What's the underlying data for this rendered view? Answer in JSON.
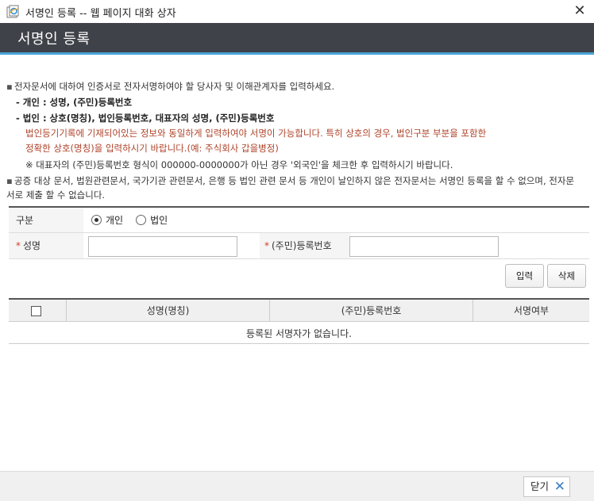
{
  "window": {
    "title": "서명인 등록 -- 웹 페이지 대화 상자",
    "close_glyph": "✕"
  },
  "header": {
    "title": "서명인 등록"
  },
  "notice": {
    "line1": "전자문서에 대하여 인증서로 전자서명하여야 할 당사자 및 이해관계자를 입력하세요.",
    "line2": "- 개인 : 성명, (주민)등록번호",
    "line3": "- 법인 : 상호(명칭), 법인등록번호, 대표자의 성명, (주민)등록번호",
    "line4": "법인등기기록에 기재되어있는 정보와 동일하게 입력하여야 서명이 가능합니다. 특히 상호의 경우, 법인구분 부분을 포함한",
    "line5": "정확한 상호(명칭)을 입력하시기 바랍니다.(예: 주식회사 갑을병정)",
    "line6": "※ 대표자의 (주민)등록번호 형식이 000000-0000000가 아닌 경우 '외국인'을 체크한 후 입력하시기 바랍니다.",
    "line7": "공증 대상 문서, 법원관련문서, 국가기관 관련문서, 은행 등 법인 관련 문서 등 개인이 날인하지 않은 전자문서는 서명인 등록을 할 수 없으며, 전자문",
    "line8": "서로 제출 할 수 없습니다.",
    "bullet": "▪"
  },
  "form": {
    "type_label": "구분",
    "radio_individual": "개인",
    "radio_corporation": "법인",
    "selected": "개인",
    "name_label": "성명",
    "reg_label": "(주민)등록번호",
    "required_mark": "*",
    "name_value": "",
    "reg_value": ""
  },
  "buttons": {
    "input": "입력",
    "delete": "삭제"
  },
  "grid": {
    "columns": [
      "성명(명칭)",
      "(주민)등록번호",
      "서명여부"
    ],
    "empty_message": "등록된 서명자가 없습니다."
  },
  "footer": {
    "close_label": "닫기",
    "close_icon": "✕"
  }
}
